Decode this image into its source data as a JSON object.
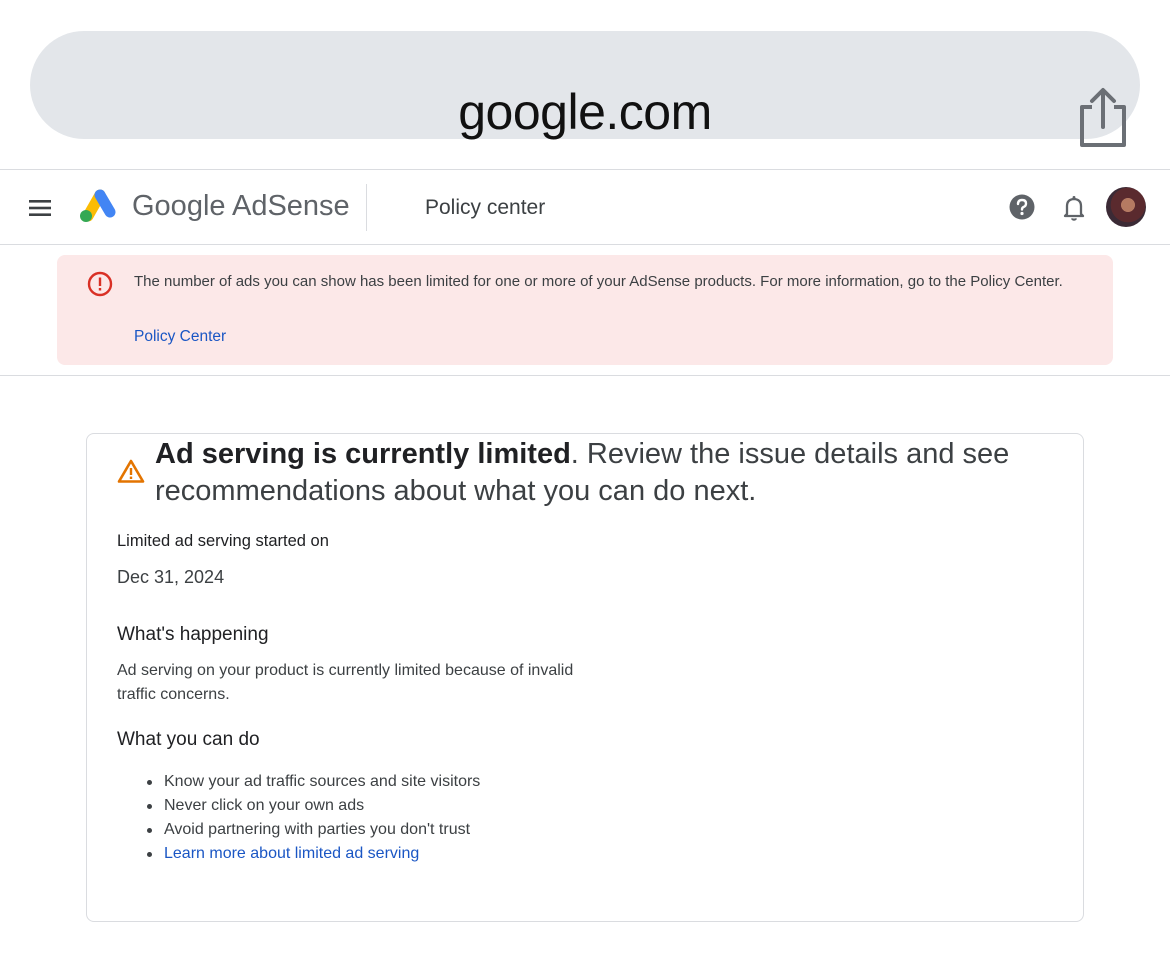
{
  "browser": {
    "url": "google.com",
    "share_icon": "share-icon"
  },
  "header": {
    "menu_icon": "menu-icon",
    "logo_text": "Google AdSense",
    "section_title": "Policy center",
    "help_icon": "help-icon",
    "bell_icon": "bell-icon",
    "avatar": "user-avatar"
  },
  "banner": {
    "icon": "error-icon",
    "message": "The number of ads you can show has been limited for one or more of your AdSense products. For more information, go to the Policy Center.",
    "link_label": "Policy Center"
  },
  "card": {
    "icon": "warning-icon",
    "headline_strong": "Ad serving is currently limited",
    "headline_rest": ". Review the issue details and see recommendations about what you can do next.",
    "started_label": "Limited ad serving started on",
    "started_date": "Dec 31, 2024",
    "happening_title": "What's happening",
    "happening_body": "Ad serving on your product is currently limited because of invalid traffic concerns.",
    "todo_title": "What you can do",
    "todo_items": [
      "Know your ad traffic sources and site visitors",
      "Never click on your own ads",
      "Avoid partnering with parties you don't trust"
    ],
    "learn_more": "Learn more about limited ad serving"
  },
  "colors": {
    "banner_bg": "#fce8e8",
    "error_red": "#d93025",
    "warning_orange": "#e37400",
    "link_blue": "#1a56c4"
  }
}
